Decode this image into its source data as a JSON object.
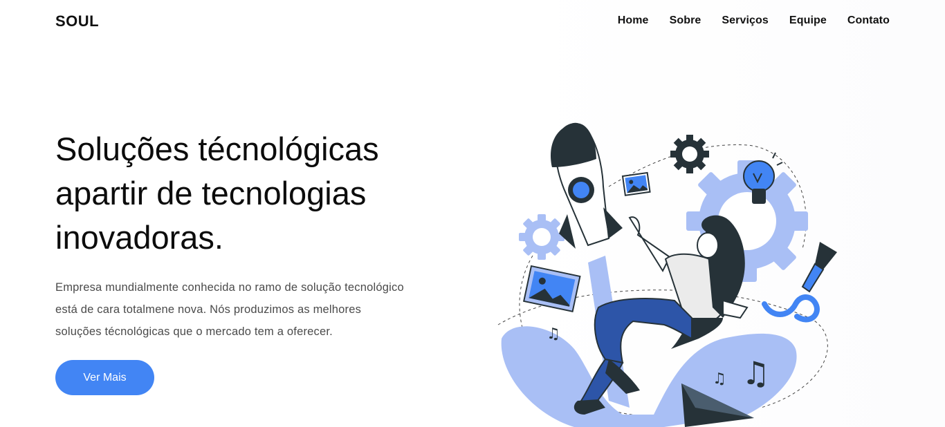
{
  "header": {
    "brand": "SOUL",
    "nav": [
      {
        "label": "Home"
      },
      {
        "label": "Sobre"
      },
      {
        "label": "Serviços"
      },
      {
        "label": "Equipe"
      },
      {
        "label": "Contato"
      }
    ]
  },
  "hero": {
    "headline_lines": [
      "Soluções técnológicas",
      "apartir de tecnologias",
      "inovadoras."
    ],
    "description_lines": [
      "Empresa mundialmente conhecida no ramo de solução tecnológico",
      "está de cara totalmene nova. Nós produzimos as melhores",
      "soluções técnológicas que o mercado tem a oferecer."
    ],
    "cta_label": "Ver Mais"
  },
  "colors": {
    "accent": "#4285f4",
    "light_accent": "#a9bff5",
    "dark": "#263238",
    "text": "#111111",
    "muted": "#4a4a4a"
  },
  "illustration": {
    "icons": [
      "rocket-icon",
      "gear-icon",
      "light-gear-icon",
      "lightbulb-icon",
      "picture-icon",
      "music-note-icon",
      "paper-plane-icon",
      "marker-icon"
    ]
  }
}
